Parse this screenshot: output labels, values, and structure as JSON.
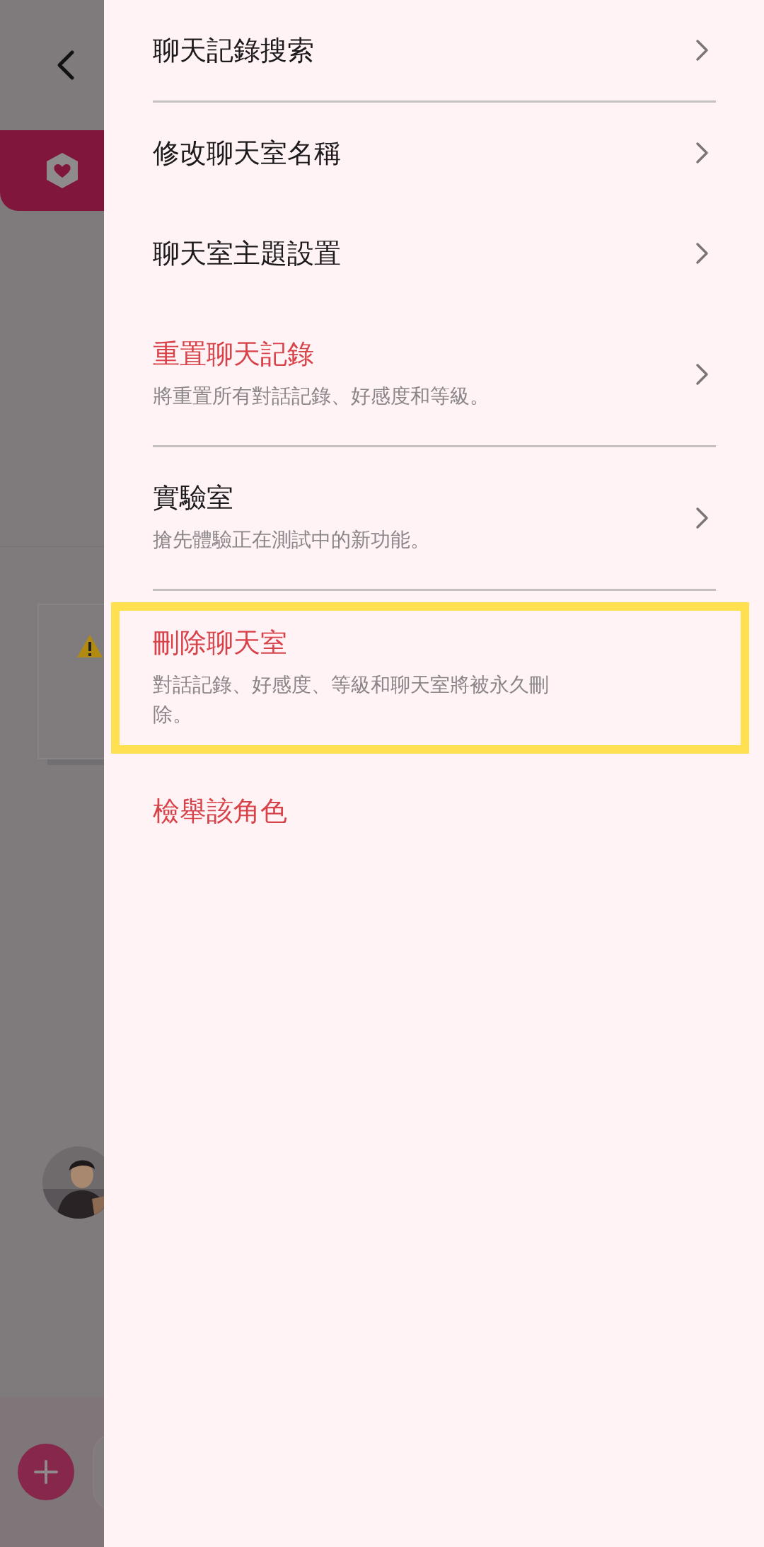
{
  "menu": {
    "items": [
      {
        "kind": "link",
        "title": "聊天記錄搜索",
        "danger": false,
        "divider_below": true,
        "highlighted": false
      },
      {
        "kind": "link",
        "title": "修改聊天室名稱",
        "danger": false,
        "divider_below": false,
        "highlighted": false
      },
      {
        "kind": "link",
        "title": "聊天室主題設置",
        "danger": false,
        "divider_below": false,
        "highlighted": false
      },
      {
        "kind": "link",
        "title": "重置聊天記錄",
        "subtitle": "將重置所有對話記錄、好感度和等級。",
        "danger": true,
        "divider_below": true,
        "highlighted": false
      },
      {
        "kind": "link",
        "title": "實驗室",
        "subtitle": "搶先體驗正在測試中的新功能。",
        "danger": false,
        "divider_below": true,
        "highlighted": false
      },
      {
        "kind": "action",
        "title": "刪除聊天室",
        "subtitle": "對話記錄、好感度、等級和聊天室將被永久刪除。",
        "danger": true,
        "divider_below": false,
        "highlighted": true
      },
      {
        "kind": "action",
        "title": "檢舉該角色",
        "danger": true,
        "divider_below": false,
        "highlighted": false
      }
    ]
  }
}
